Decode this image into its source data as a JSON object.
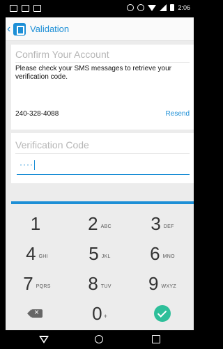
{
  "status_bar": {
    "time": "2:06"
  },
  "app_bar": {
    "title": "Validation"
  },
  "confirm_card": {
    "heading": "Confirm Your Account",
    "message": "Please check your SMS messages to retrieve your verification code.",
    "phone_number": "240-328-4088",
    "resend_label": "Resend"
  },
  "verification_card": {
    "heading": "Verification Code",
    "code_value": "····"
  },
  "keypad": {
    "keys": [
      {
        "number": "1",
        "letters": ""
      },
      {
        "number": "2",
        "letters": "ABC"
      },
      {
        "number": "3",
        "letters": "DEF"
      },
      {
        "number": "4",
        "letters": "GHI"
      },
      {
        "number": "5",
        "letters": "JKL"
      },
      {
        "number": "6",
        "letters": "MNO"
      },
      {
        "number": "7",
        "letters": "PQRS"
      },
      {
        "number": "8",
        "letters": "TUV"
      },
      {
        "number": "9",
        "letters": "WXYZ"
      }
    ],
    "zero": {
      "number": "0",
      "letters": "+"
    }
  },
  "icons": {
    "back": "chevron-left-icon",
    "app": "app-logo-icon",
    "backspace": "backspace-icon",
    "done": "checkmark-icon"
  },
  "colors": {
    "accent": "#1d8fd6",
    "done": "#2ebf9a",
    "background": "#ececec"
  }
}
